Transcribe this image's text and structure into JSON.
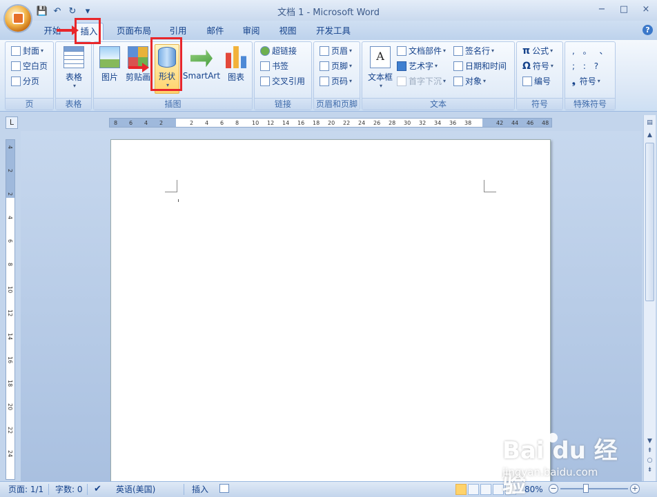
{
  "window": {
    "title": "文档 1 - Microsoft Word",
    "minimize": "−",
    "maximize": "□",
    "close": "×"
  },
  "qat": {
    "save": "💾",
    "undo": "↶",
    "redo": "↻",
    "more": "▾"
  },
  "tabs": [
    {
      "label": "开始"
    },
    {
      "label": "插入"
    },
    {
      "label": "页面布局"
    },
    {
      "label": "引用"
    },
    {
      "label": "邮件"
    },
    {
      "label": "审阅"
    },
    {
      "label": "视图"
    },
    {
      "label": "开发工具"
    }
  ],
  "help": "?",
  "ribbon": {
    "page": {
      "label": "页",
      "cover": "封面",
      "blank": "空白页",
      "break": "分页"
    },
    "table": {
      "label": "表格",
      "button": "表格"
    },
    "illustrations": {
      "label": "插图",
      "picture": "图片",
      "clipart": "剪贴画",
      "shapes": "形状",
      "smartart": "SmartArt",
      "chart": "图表"
    },
    "links": {
      "label": "链接",
      "hyperlink": "超链接",
      "bookmark": "书签",
      "crossref": "交叉引用"
    },
    "headerfooter": {
      "label": "页眉和页脚",
      "header": "页眉",
      "footer": "页脚",
      "pagenum": "页码"
    },
    "text": {
      "label": "文本",
      "textbox": "文本框",
      "quickparts": "文档部件",
      "wordart": "艺术字",
      "dropcap": "首字下沉",
      "signature": "签名行",
      "datetime": "日期和时间",
      "object": "对象"
    },
    "symbols": {
      "label": "符号",
      "equation": "公式",
      "symbol": "符号",
      "number": "编号"
    },
    "special": {
      "label": "特殊符号",
      "row1": ",  。 、",
      "row2": ";  :  ?",
      "symbol": "符号"
    }
  },
  "ruler": {
    "h_ticks": [
      "8",
      "6",
      "4",
      "2",
      "2",
      "4",
      "6",
      "8",
      "10",
      "12",
      "14",
      "16",
      "18",
      "20",
      "22",
      "24",
      "26",
      "28",
      "30",
      "32",
      "34",
      "36",
      "38",
      "42",
      "44",
      "46",
      "48"
    ],
    "v_ticks": [
      "4",
      "2",
      "2",
      "4",
      "6",
      "8",
      "10",
      "12",
      "14",
      "16",
      "18",
      "20",
      "22",
      "24"
    ],
    "tab_selector": "L"
  },
  "status": {
    "page": "页面: 1/1",
    "words": "字数: 0",
    "language": "英语(美国)",
    "mode": "插入",
    "zoom": "80%",
    "zoom_minus": "−",
    "zoom_plus": "+"
  },
  "watermark": {
    "brand": "Bai du 经验",
    "sub": "jingyan.baidu.com"
  },
  "colors": {
    "highlight": "#e8262a",
    "ribbon_text": "#15428b"
  }
}
